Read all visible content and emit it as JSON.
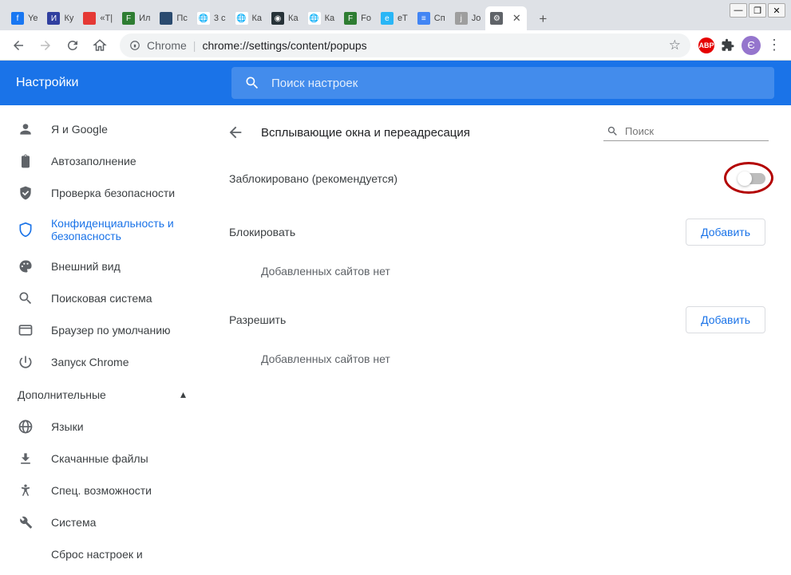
{
  "window": {
    "min": "—",
    "max": "❐",
    "close": "✕"
  },
  "tabs": [
    {
      "label": "Ye",
      "favicon_bg": "#1877f2",
      "favicon_text": "f"
    },
    {
      "label": "Ку",
      "favicon_bg": "#303f9f",
      "favicon_text": "И"
    },
    {
      "label": "«Т|",
      "favicon_bg": "#e53935",
      "favicon_text": ""
    },
    {
      "label": "Ил",
      "favicon_bg": "#2e7d32",
      "favicon_text": "F"
    },
    {
      "label": "Пс",
      "favicon_bg": "#2b4b6f",
      "favicon_text": ""
    },
    {
      "label": "3 с",
      "favicon_bg": "#ffffff",
      "favicon_text": "🌐"
    },
    {
      "label": "Ка",
      "favicon_bg": "#ffffff",
      "favicon_text": "🌐"
    },
    {
      "label": "Ка",
      "favicon_bg": "#263238",
      "favicon_text": "◉"
    },
    {
      "label": "Ка",
      "favicon_bg": "#ffffff",
      "favicon_text": "🌐"
    },
    {
      "label": "Fo",
      "favicon_bg": "#2e7d32",
      "favicon_text": "F"
    },
    {
      "label": "eT",
      "favicon_bg": "#29b6f6",
      "favicon_text": "e"
    },
    {
      "label": "Сп",
      "favicon_bg": "#4285f4",
      "favicon_text": "≡"
    },
    {
      "label": "Jo",
      "favicon_bg": "#9e9e9e",
      "favicon_text": "j"
    },
    {
      "label": "",
      "favicon_bg": "#5f6368",
      "favicon_text": "⚙",
      "active": true
    }
  ],
  "tabAdd": "+",
  "toolbar": {
    "scheme_icon": "🔒",
    "scheme": "Chrome",
    "sep": "|",
    "url": "chrome://settings/content/popups",
    "star": "☆",
    "abp": "ABP",
    "ext": "✦",
    "profile": "Є",
    "menu": "⋮"
  },
  "settingsHeader": {
    "title": "Настройки",
    "searchPlaceholder": "Поиск настроек"
  },
  "sidebar": {
    "items": [
      {
        "icon": "person",
        "label": "Я и Google"
      },
      {
        "icon": "clipboard",
        "label": "Автозаполнение"
      },
      {
        "icon": "shield-check",
        "label": "Проверка безопасности"
      },
      {
        "icon": "shield",
        "label": "Конфиденциальность и безопасность",
        "active": true
      },
      {
        "icon": "palette",
        "label": "Внешний вид"
      },
      {
        "icon": "search",
        "label": "Поисковая система"
      },
      {
        "icon": "window",
        "label": "Браузер по умолчанию"
      },
      {
        "icon": "power",
        "label": "Запуск Chrome"
      }
    ],
    "sectionLabel": "Дополнительные",
    "extra": [
      {
        "icon": "globe",
        "label": "Языки"
      },
      {
        "icon": "download",
        "label": "Скачанные файлы"
      },
      {
        "icon": "accessibility",
        "label": "Спец. возможности"
      },
      {
        "icon": "wrench",
        "label": "Система"
      },
      {
        "icon": "",
        "label": "Сброс настроек и"
      }
    ]
  },
  "content": {
    "title": "Всплывающие окна и переадресация",
    "searchPlaceholder": "Поиск",
    "blockedLabel": "Заблокировано (рекомендуется)",
    "blockSection": "Блокировать",
    "allowSection": "Разрешить",
    "addBtn": "Добавить",
    "emptyText": "Добавленных сайтов нет"
  }
}
